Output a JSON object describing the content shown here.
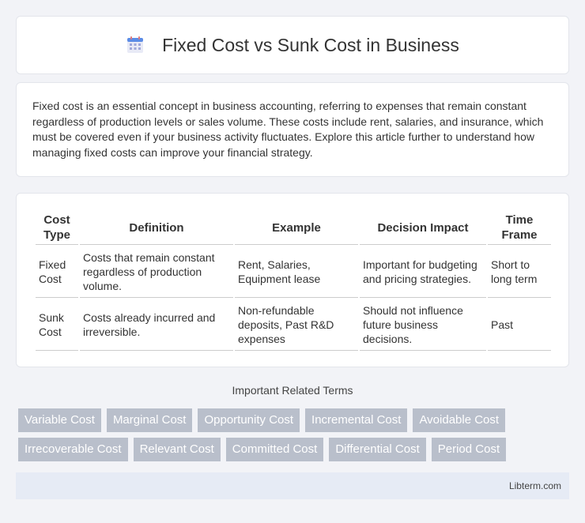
{
  "header": {
    "title": "Fixed Cost vs Sunk Cost in Business",
    "icon": "calendar-icon"
  },
  "intro": {
    "text": "Fixed cost is an essential concept in business accounting, referring to expenses that remain constant regardless of production levels or sales volume. These costs include rent, salaries, and insurance, which must be covered even if your business activity fluctuates. Explore this article further to understand how managing fixed costs can improve your financial strategy."
  },
  "table": {
    "headers": [
      "Cost Type",
      "Definition",
      "Example",
      "Decision Impact",
      "Time Frame"
    ],
    "rows": [
      [
        "Fixed Cost",
        "Costs that remain constant regardless of production volume.",
        "Rent, Salaries, Equipment lease",
        "Important for budgeting and pricing strategies.",
        "Short to long term"
      ],
      [
        "Sunk Cost",
        "Costs already incurred and irreversible.",
        "Non-refundable deposits, Past R&D expenses",
        "Should not influence future business decisions.",
        "Past"
      ]
    ]
  },
  "related": {
    "title": "Important Related Terms",
    "row1": [
      "Variable Cost",
      "Marginal Cost",
      "Opportunity Cost",
      "Incremental Cost",
      "Avoidable Cost"
    ],
    "row2": [
      "Irrecoverable Cost",
      "Relevant Cost",
      "Committed Cost",
      "Differential Cost",
      "Period Cost"
    ]
  },
  "footer": {
    "brand": "Libterm.com"
  },
  "colors": {
    "tag_bg": "#b9bfcb",
    "footer_bg": "#e6ebf5",
    "page_bg": "#f2f3f7"
  }
}
